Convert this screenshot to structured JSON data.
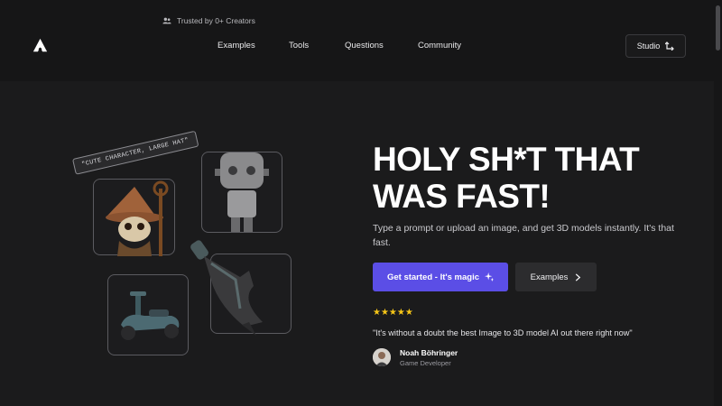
{
  "banner": {
    "trusted_text": "Trusted by 0+ Creators",
    "icon": "users-icon"
  },
  "nav": {
    "logo_icon": "triangle-logo-icon",
    "items": [
      {
        "label": "Examples"
      },
      {
        "label": "Tools"
      },
      {
        "label": "Questions"
      },
      {
        "label": "Community"
      }
    ],
    "studio_label": "Studio",
    "studio_icon": "corner-arrow-icon"
  },
  "hero": {
    "prompt_tag": "\"CUTE CHARACTER, LARGE HAT\"",
    "headline_line1": "HOLY SH*T THAT",
    "headline_line2": "WAS FAST!",
    "subtext": "Type a prompt or upload an image, and get 3D models instantly. It's that fast.",
    "primary_cta": "Get started - It's magic",
    "primary_cta_icon": "sparkle-icon",
    "secondary_cta": "Examples",
    "secondary_cta_icon": "chevron-right-icon",
    "rating_stars": "★★★★★",
    "quote": "\"It's without a doubt the best Image to 3D model AI out there right now\"",
    "author_name": "Noah Böhringer",
    "author_role": "Game Developer"
  },
  "colors": {
    "background": "#1b1b1c",
    "accent": "#5b4ee6",
    "star": "#f5c518"
  }
}
